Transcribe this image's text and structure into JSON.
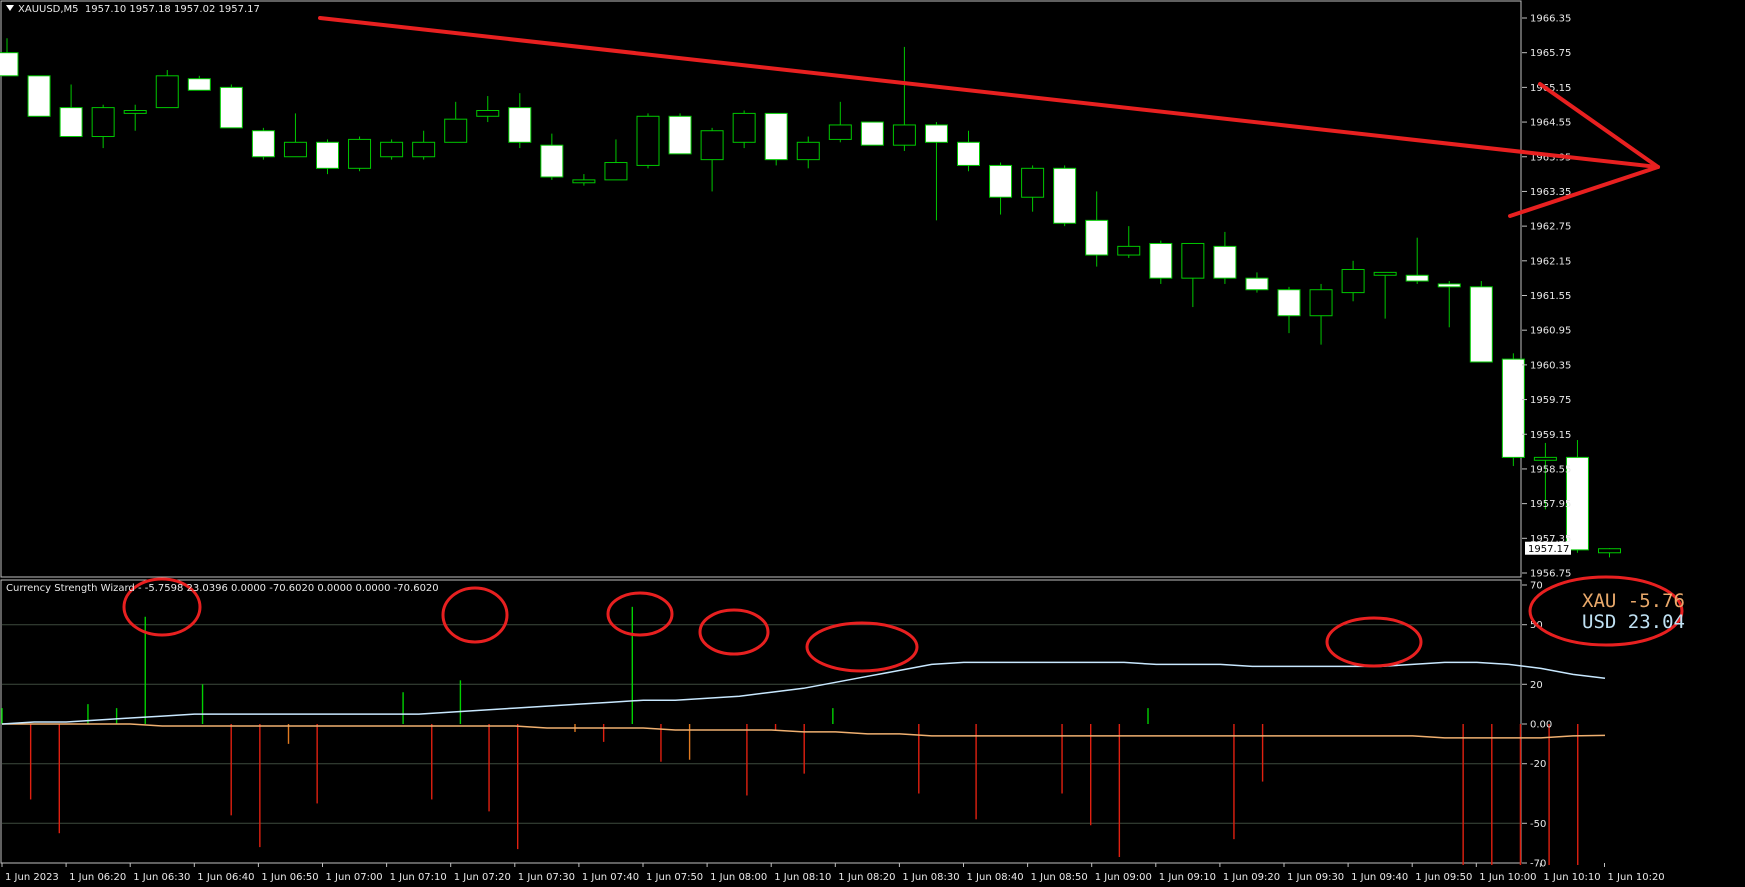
{
  "symbol_header": "XAUUSD,M5  1957.10 1957.18 1957.02 1957.17",
  "indicator_header": "Currency Strength Wizard - -5.7598 23.0396 0.0000 -70.6020 0.0000 0.0000 -70.6020",
  "strength_panel": {
    "rows": [
      {
        "label": "XAU",
        "value": "-5.76",
        "color": "#e9a96b"
      },
      {
        "label": "USD",
        "value": "23.04",
        "color": "#bfe0f2"
      }
    ]
  },
  "colors": {
    "background": "#000000",
    "bull_candle": "#00c800",
    "bear_candle": "#ffffff",
    "positive_histogram": "#00d000",
    "negative_histogram": "#e02010",
    "xau_line": "#f0b070",
    "usd_line": "#c8e8ff",
    "annotation": "#e82020"
  },
  "chart_data": [
    {
      "type": "candlestick",
      "title": "XAUUSD,M5",
      "ylim": [
        1956.6,
        1966.6
      ],
      "y_ticks": [
        "1966.35",
        "1965.75",
        "1965.15",
        "1964.55",
        "1963.95",
        "1963.35",
        "1962.75",
        "1962.15",
        "1961.55",
        "1960.95",
        "1960.35",
        "1959.75",
        "1959.15",
        "1958.55",
        "1957.95",
        "1957.35",
        "1956.75"
      ],
      "current_price": "1957.17",
      "x_tick_labels": [
        "1 Jun 2023",
        "1 Jun 06:20",
        "1 Jun 06:30",
        "1 Jun 06:40",
        "1 Jun 06:50",
        "1 Jun 07:00",
        "1 Jun 07:10",
        "1 Jun 07:20",
        "1 Jun 07:30",
        "1 Jun 07:40",
        "1 Jun 07:50",
        "1 Jun 08:00",
        "1 Jun 08:10",
        "1 Jun 08:20",
        "1 Jun 08:30",
        "1 Jun 08:40",
        "1 Jun 08:50",
        "1 Jun 09:00",
        "1 Jun 09:10",
        "1 Jun 09:20",
        "1 Jun 09:30",
        "1 Jun 09:40",
        "1 Jun 09:50",
        "1 Jun 10:00",
        "1 Jun 10:10",
        "1 Jun 10:20"
      ],
      "candles": [
        [
          1965.75,
          1966.0,
          1965.35,
          1965.35
        ],
        [
          1965.35,
          1965.35,
          1964.65,
          1964.65
        ],
        [
          1964.8,
          1965.2,
          1964.35,
          1964.3
        ],
        [
          1964.3,
          1964.85,
          1964.1,
          1964.8
        ],
        [
          1964.7,
          1964.85,
          1964.4,
          1964.75
        ],
        [
          1964.8,
          1965.45,
          1964.8,
          1965.35
        ],
        [
          1965.3,
          1965.35,
          1965.1,
          1965.1
        ],
        [
          1965.15,
          1965.2,
          1964.45,
          1964.45
        ],
        [
          1964.4,
          1964.45,
          1963.9,
          1963.95
        ],
        [
          1963.95,
          1964.7,
          1963.95,
          1964.2
        ],
        [
          1964.2,
          1964.25,
          1963.65,
          1963.75
        ],
        [
          1963.75,
          1964.3,
          1963.7,
          1964.25
        ],
        [
          1963.95,
          1964.25,
          1963.9,
          1964.2
        ],
        [
          1963.95,
          1964.4,
          1963.9,
          1964.2
        ],
        [
          1964.2,
          1964.9,
          1964.2,
          1964.6
        ],
        [
          1964.65,
          1965.0,
          1964.55,
          1964.75
        ],
        [
          1964.8,
          1965.05,
          1964.1,
          1964.2
        ],
        [
          1964.15,
          1964.35,
          1963.55,
          1963.6
        ],
        [
          1963.5,
          1963.65,
          1963.45,
          1963.55
        ],
        [
          1963.55,
          1964.25,
          1963.55,
          1963.85
        ],
        [
          1963.8,
          1964.7,
          1963.75,
          1964.65
        ],
        [
          1964.65,
          1964.7,
          1964.0,
          1964.0
        ],
        [
          1963.9,
          1964.45,
          1963.35,
          1964.4
        ],
        [
          1964.2,
          1964.75,
          1964.1,
          1964.7
        ],
        [
          1964.7,
          1964.7,
          1963.8,
          1963.9
        ],
        [
          1963.9,
          1964.3,
          1963.75,
          1964.2
        ],
        [
          1964.25,
          1964.9,
          1964.2,
          1964.5
        ],
        [
          1964.55,
          1964.55,
          1964.15,
          1964.15
        ],
        [
          1964.15,
          1965.85,
          1964.05,
          1964.5
        ],
        [
          1964.5,
          1964.55,
          1962.85,
          1964.2
        ],
        [
          1964.2,
          1964.4,
          1963.7,
          1963.8
        ],
        [
          1963.8,
          1963.85,
          1962.95,
          1963.25
        ],
        [
          1963.25,
          1963.8,
          1963.0,
          1963.75
        ],
        [
          1963.75,
          1963.8,
          1962.75,
          1962.8
        ],
        [
          1962.85,
          1963.35,
          1962.05,
          1962.25
        ],
        [
          1962.25,
          1962.75,
          1962.2,
          1962.4
        ],
        [
          1962.45,
          1962.5,
          1961.75,
          1961.85
        ],
        [
          1961.85,
          1962.45,
          1961.35,
          1962.45
        ],
        [
          1962.4,
          1962.65,
          1961.75,
          1961.85
        ],
        [
          1961.85,
          1961.95,
          1961.6,
          1961.65
        ],
        [
          1961.65,
          1961.7,
          1960.9,
          1961.2
        ],
        [
          1961.2,
          1961.75,
          1960.7,
          1961.65
        ],
        [
          1961.6,
          1962.15,
          1961.45,
          1962.0
        ],
        [
          1961.9,
          1961.95,
          1961.15,
          1961.95
        ],
        [
          1961.9,
          1962.55,
          1961.75,
          1961.8
        ],
        [
          1961.75,
          1961.8,
          1961.0,
          1961.7
        ],
        [
          1961.7,
          1961.8,
          1960.4,
          1960.4
        ],
        [
          1960.45,
          1960.55,
          1958.6,
          1958.75
        ],
        [
          1958.7,
          1959.0,
          1957.85,
          1958.75
        ],
        [
          1958.75,
          1959.05,
          1957.1,
          1957.15
        ],
        [
          1957.1,
          1957.18,
          1957.02,
          1957.17
        ]
      ]
    },
    {
      "type": "bar",
      "title": "Currency Strength Wizard",
      "ylim": [
        -70,
        70
      ],
      "y_ticks": [
        "70",
        "50",
        "20",
        "0.00",
        "-20",
        "-50",
        "-70"
      ],
      "series": [
        {
          "name": "XAU",
          "line": [
            0,
            0,
            0,
            0,
            0,
            -1,
            -1,
            -1,
            -1,
            -1,
            -1,
            -1,
            -1,
            -1,
            -1,
            -1,
            -1,
            -2,
            -2,
            -2,
            -2,
            -3,
            -3,
            -3,
            -3,
            -4,
            -4,
            -5,
            -5,
            -6,
            -6,
            -6,
            -6,
            -6,
            -6,
            -6,
            -6,
            -6,
            -6,
            -6,
            -6,
            -6,
            -6,
            -6,
            -6,
            -7,
            -7,
            -7,
            -7,
            -6,
            -5.76
          ]
        },
        {
          "name": "USD",
          "line": [
            0,
            1,
            1,
            2,
            3,
            4,
            5,
            5,
            5,
            5,
            5,
            5,
            5,
            5,
            6,
            7,
            8,
            9,
            10,
            11,
            12,
            12,
            13,
            14,
            16,
            18,
            21,
            24,
            27,
            30,
            31,
            31,
            31,
            31,
            31,
            31,
            30,
            30,
            30,
            29,
            29,
            29,
            29,
            29,
            30,
            31,
            31,
            30,
            28,
            25,
            23.04
          ]
        },
        {
          "name": "positive_histogram",
          "values": [
            8,
            0,
            0,
            10,
            8,
            54,
            0,
            20,
            0,
            0,
            0,
            0,
            0,
            0,
            16,
            0,
            22,
            0,
            0,
            0,
            0,
            0,
            59,
            0,
            0,
            0,
            0,
            0,
            0,
            8,
            0,
            0,
            0,
            0,
            0,
            0,
            0,
            0,
            0,
            0,
            8,
            0,
            0,
            0,
            0,
            0,
            0,
            0,
            0,
            0,
            0,
            0,
            0,
            0,
            0,
            0,
            0,
            0,
            0,
            0,
            0,
            0,
            0,
            0,
            0
          ]
        },
        {
          "name": "negative_histogram",
          "values": [
            0,
            -38,
            -55,
            0,
            0,
            0,
            0,
            0,
            -46,
            -62,
            -10,
            -40,
            0,
            0,
            0,
            -38,
            0,
            -44,
            -63,
            0,
            -4,
            -9,
            0,
            -19,
            -18,
            0,
            -36,
            -3,
            -25,
            0,
            0,
            0,
            -35,
            0,
            -48,
            0,
            0,
            -35,
            -51,
            -67,
            0,
            0,
            0,
            -58,
            -29,
            0,
            0,
            0,
            0,
            0,
            0,
            -71,
            -71,
            -71,
            -71,
            -71
          ]
        }
      ]
    }
  ]
}
